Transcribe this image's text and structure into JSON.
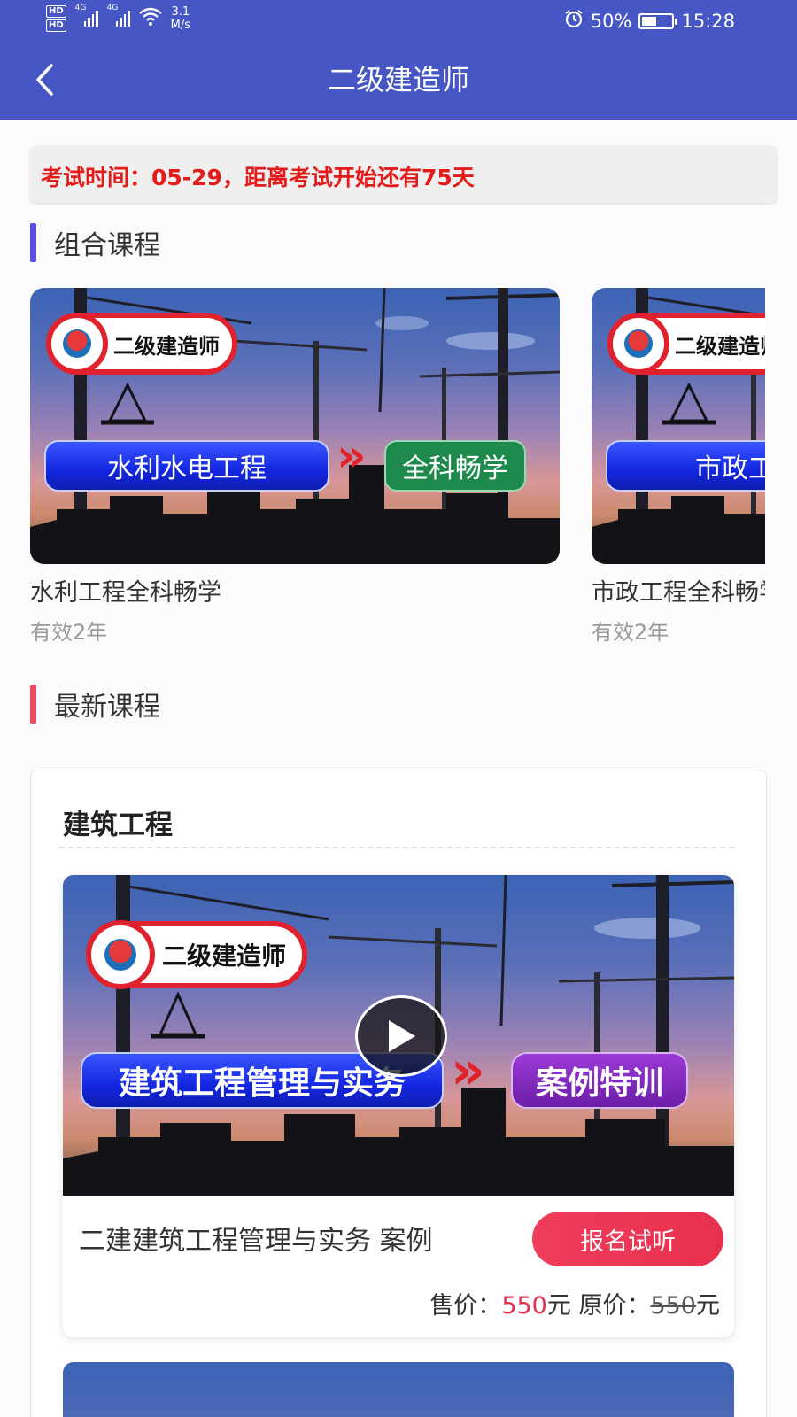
{
  "status_bar": {
    "hd1": "HD",
    "hd2": "HD",
    "net1": "4G",
    "net2": "4G",
    "speed_value": "3.1",
    "speed_unit": "M/s",
    "battery_percent": "50%",
    "battery_level": 0.5,
    "time": "15:28",
    "icons": [
      "alarm-icon",
      "wifi-icon",
      "battery-icon",
      "signal-icon"
    ]
  },
  "header": {
    "title": "二级建造师",
    "back_icon": "chevron-left-icon",
    "background": "#4656c4"
  },
  "exam_notice": "考试时间：05-29，距离考试开始还有75天",
  "sections": {
    "combo_title": "组合课程",
    "combo_accent": "#5b4ee6",
    "latest_title": "最新课程",
    "latest_accent": "#ef4a5f"
  },
  "combo_courses": [
    {
      "name": "水利工程全科畅学",
      "validity": "有效2年",
      "thumb_logo": "二级建造师",
      "thumb_subject": "水利水电工程",
      "thumb_tag": "全科畅学"
    },
    {
      "name": "市政工程全科畅学",
      "validity": "有效2年",
      "thumb_logo": "二级建造师",
      "thumb_subject": "市政工程",
      "thumb_tag": ""
    }
  ],
  "latest": {
    "category": "建筑工程",
    "courses": [
      {
        "name": "二建建筑工程管理与实务 案例",
        "enroll_label": "报名试听",
        "sale_label": "售价：",
        "sale_price": "550",
        "original_label": "原价：",
        "original_price": "550",
        "currency": "元",
        "thumb_logo": "二级建造师",
        "thumb_subject": "建筑工程管理与实务",
        "thumb_tag": "案例特训",
        "play_icon": "play-icon"
      }
    ]
  },
  "colors": {
    "accent_red": "#e8304e",
    "notice_red": "#e41b1b"
  }
}
